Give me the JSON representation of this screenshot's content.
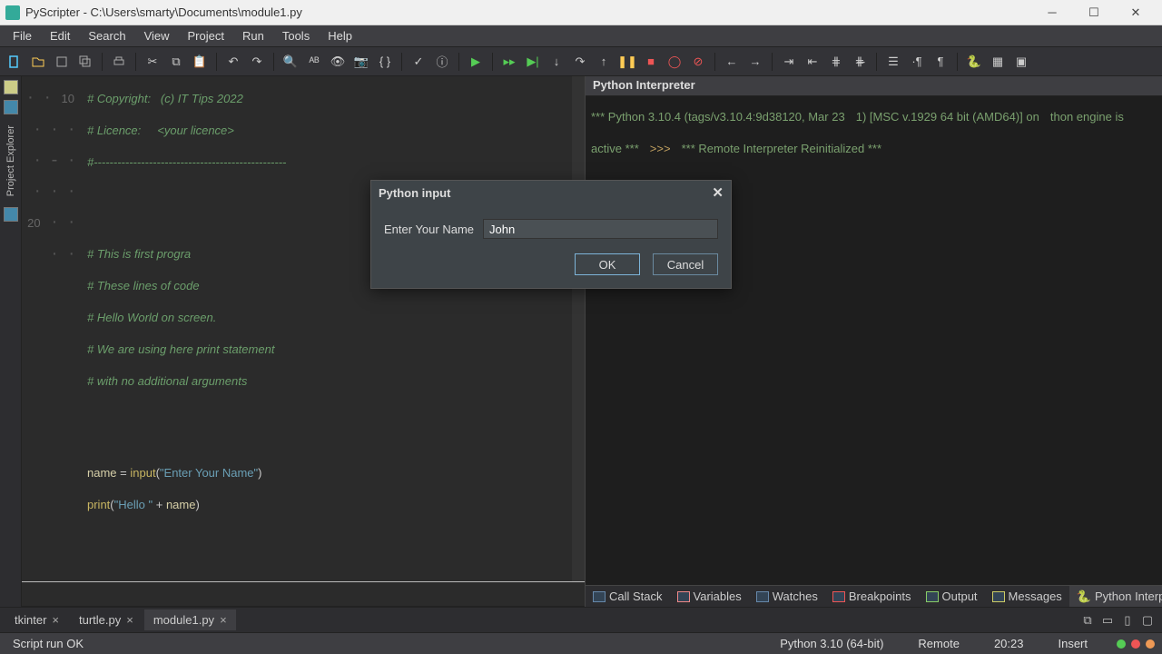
{
  "title": "PyScripter - C:\\Users\\smarty\\Documents\\module1.py",
  "menu": [
    "File",
    "Edit",
    "Search",
    "View",
    "Project",
    "Run",
    "Tools",
    "Help"
  ],
  "sidebar_label": "Project Explorer",
  "line_a": "10",
  "line_b": "20",
  "code": {
    "l1": "# Copyright:   (c) IT Tips 2022",
    "l2": "# Licence:     <your licence>",
    "l3": "#-------------------------------------------------",
    "l4": "# This is first progra",
    "l5": "# These lines of code",
    "l6": "# Hello World on screen.",
    "l7": "# We are using here print statement",
    "l8": "# with no additional arguments",
    "kw_name": "name",
    "eq": " = ",
    "fn_input": "input",
    "paren_o": "(",
    "str_prompt": "\"Enter Your Name\"",
    "paren_c": ")",
    "fn_print": "print",
    "str_hello": "\"Hello \"",
    "plus": " + ",
    "var_name": "name"
  },
  "interp": {
    "title": "Python Interpreter",
    "l1": "*** Python 3.10.4 (tags/v3.10.4:9d38120, Mar 23",
    "l2": "1) [MSC v.1929 64 bit (AMD64)] on",
    "l3": "thon engine is active ***",
    "prompt": ">>>",
    "l4": "*** Remote Interpreter Reinitialized ***"
  },
  "rtabs": [
    "Call Stack",
    "Variables",
    "Watches",
    "Breakpoints",
    "Output",
    "Messages",
    "Python Interpreter"
  ],
  "ftabs": [
    {
      "name": "tkinter"
    },
    {
      "name": "turtle.py"
    },
    {
      "name": "module1.py"
    }
  ],
  "status": {
    "left": "Script run OK",
    "py": "Python 3.10 (64-bit)",
    "mode": "Remote",
    "pos": "20:23",
    "ins": "Insert"
  },
  "dialog": {
    "title": "Python input",
    "label": "Enter Your Name",
    "value": "John",
    "ok": "OK",
    "cancel": "Cancel"
  }
}
